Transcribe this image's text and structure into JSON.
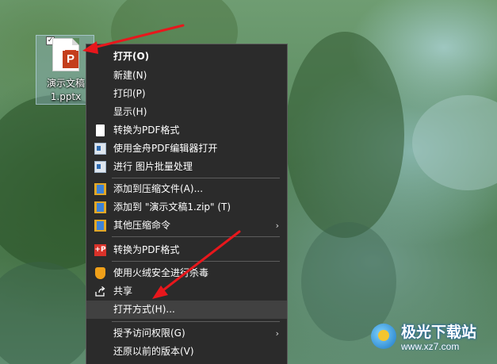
{
  "desktop": {
    "file": {
      "name": "演示文稿1.pptx",
      "badge": "P",
      "checkbox_mark": "✓"
    }
  },
  "context_menu": {
    "items": [
      {
        "label": "打开(O)",
        "bold": true
      },
      {
        "label": "新建(N)"
      },
      {
        "label": "打印(P)"
      },
      {
        "label": "显示(H)"
      },
      {
        "label": "转换为PDF格式",
        "icon": "document-icon"
      },
      {
        "label": "使用金舟PDF编辑器打开",
        "icon": "pdf-editor-icon"
      },
      {
        "label": "进行 图片批量处理",
        "icon": "image-batch-icon"
      },
      {
        "label": "添加到压缩文件(A)...",
        "icon": "archive-icon"
      },
      {
        "label": "添加到 \"演示文稿1.zip\" (T)",
        "icon": "archive-icon"
      },
      {
        "label": "其他压缩命令",
        "icon": "archive-icon",
        "submenu": true
      },
      {
        "label": "转换为PDF格式",
        "icon": "pdf-convert-icon",
        "icon_text": "+P"
      },
      {
        "label": "使用火绒安全进行杀毒",
        "icon": "shield-icon"
      },
      {
        "label": "共享",
        "icon": "share-icon"
      },
      {
        "label": "打开方式(H)...",
        "highlighted": true
      },
      {
        "label": "授予访问权限(G)",
        "submenu": true
      },
      {
        "label": "还原以前的版本(V)"
      }
    ],
    "submenu_arrow": "›"
  },
  "watermark": {
    "title": "极光下载站",
    "url": "www.xz7.com"
  },
  "colors": {
    "menu_bg": "#2b2b2b",
    "menu_highlight": "#414141",
    "annotation_arrow": "#e8171c",
    "ppt_brand": "#c43e1c"
  }
}
